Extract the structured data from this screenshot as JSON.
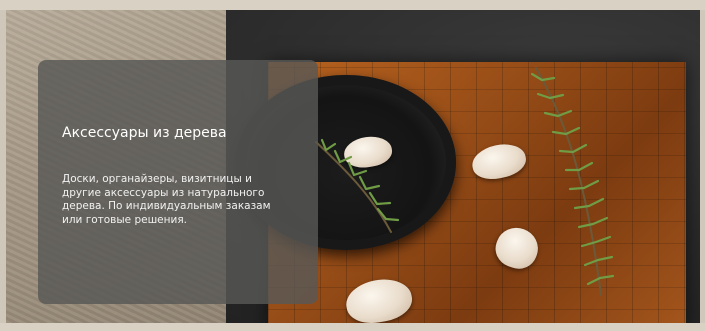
{
  "banner": {
    "title": "Аксессуары из дерева",
    "description": "Доски, органайзеры, визитницы и другие аксессуары из натурального дерева. По индивидуальным заказам или готовые решения."
  },
  "background": {
    "image": "wooden-board-with-garlic-and-rosemary-photo"
  },
  "colors": {
    "card_background": "#585856",
    "text": "#ffffff",
    "frame": "#d8d1c4",
    "board": "#9a4f18"
  }
}
